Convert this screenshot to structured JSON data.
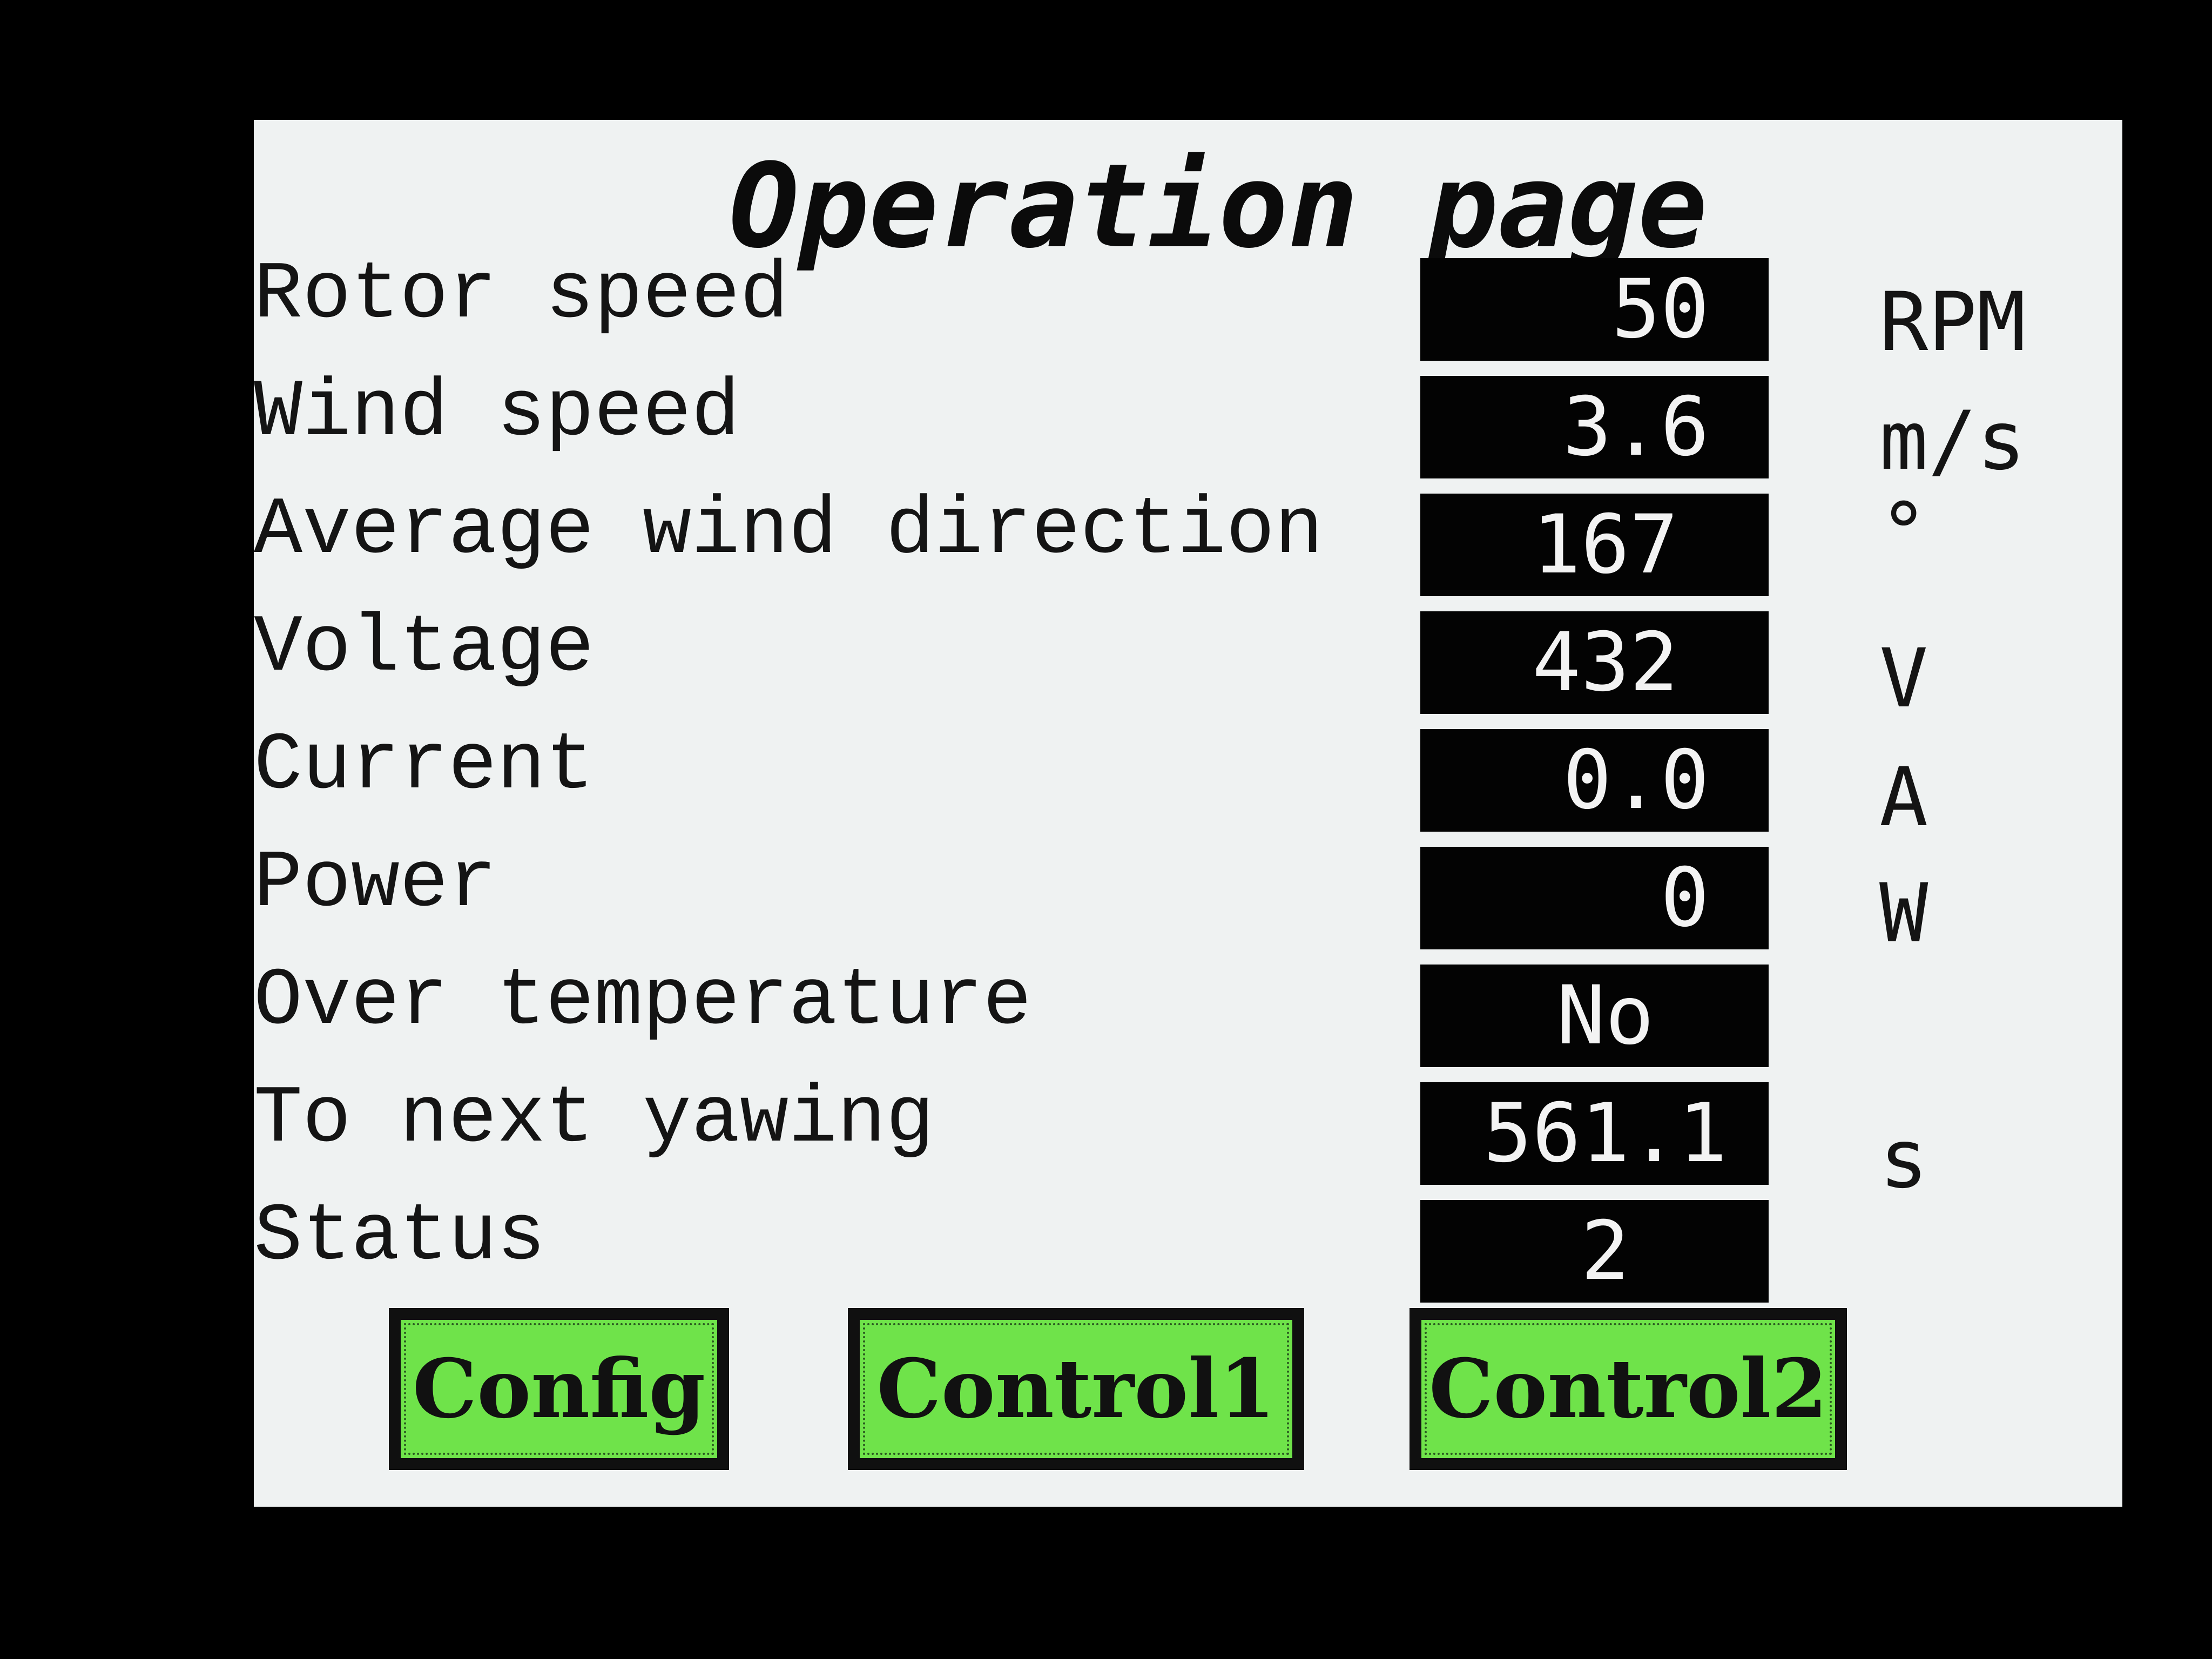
{
  "page": {
    "title": "Operation page"
  },
  "rows": [
    {
      "label": "Rotor speed",
      "value": "50",
      "unit": "RPM"
    },
    {
      "label": "Wind speed",
      "value": "3.6",
      "unit": "m/s"
    },
    {
      "label": "Average wind direction",
      "value": "167",
      "unit": "°"
    },
    {
      "label": "Voltage",
      "value": "432",
      "unit": "V"
    },
    {
      "label": "Current",
      "value": "0.0",
      "unit": "A"
    },
    {
      "label": "Power",
      "value": "0",
      "unit": "W"
    },
    {
      "label": "Over temperature",
      "value": "No",
      "unit": ""
    },
    {
      "label": "To next yawing",
      "value": "561.1",
      "unit": "s"
    },
    {
      "label": "Status",
      "value": "2",
      "unit": ""
    }
  ],
  "buttons": {
    "config": "Config",
    "control1": "Control1",
    "control2": "Control2"
  },
  "colors": {
    "screen_background": "#eff2f2",
    "value_box": "#030303",
    "button_green": "#6fe34a"
  }
}
